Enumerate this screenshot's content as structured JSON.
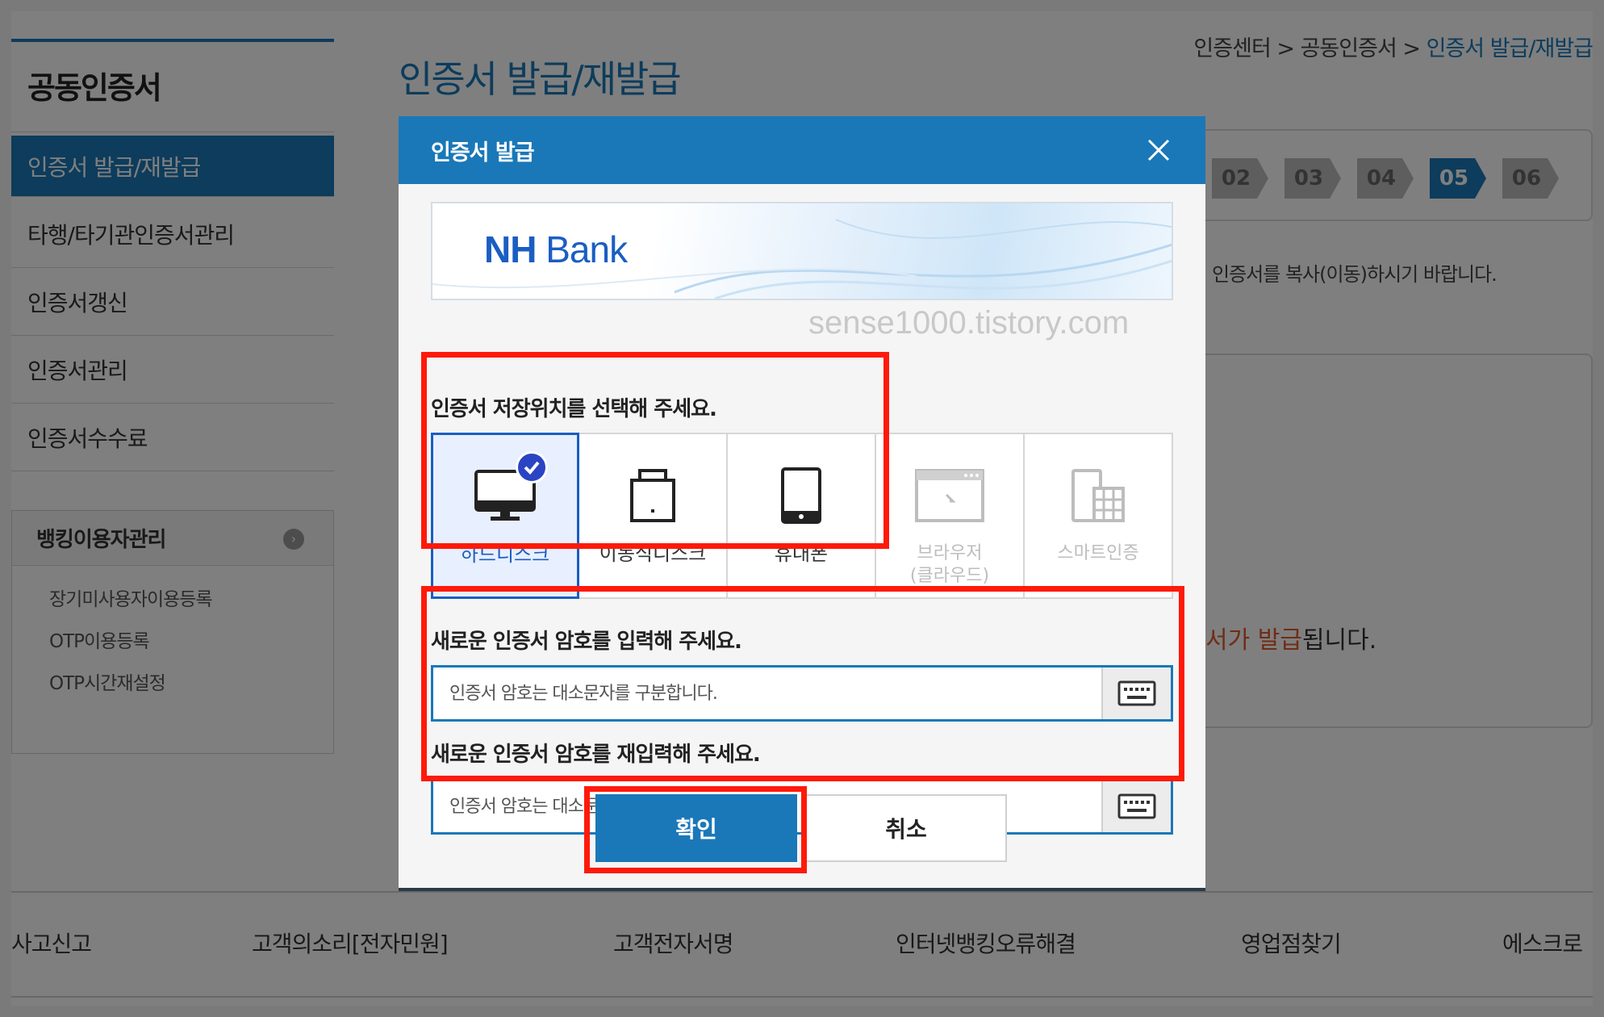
{
  "sidebar": {
    "title": "공동인증서",
    "items": [
      {
        "label": "인증서 발급/재발급",
        "active": true
      },
      {
        "label": "타행/타기관인증서관리"
      },
      {
        "label": "인증서갱신"
      },
      {
        "label": "인증서관리"
      },
      {
        "label": "인증서수수료"
      }
    ],
    "banking": {
      "title": "뱅킹이용자관리",
      "items": [
        "장기미사용자이용등록",
        "OTP이용등록",
        "OTP시간재설정"
      ]
    }
  },
  "main": {
    "title": "인증서 발급/재발급",
    "breadcrumb": {
      "part1": "인증센터",
      "sep1": " > ",
      "part2": "공동인증서",
      "sep2": " > ",
      "current": "인증서 발급/재발급"
    },
    "steps": [
      "02",
      "03",
      "04",
      "05",
      "06"
    ],
    "active_step": "05",
    "hint": "인증서를 복사(이동)하시기 바랍니다.",
    "issue_text_highlight": "서가 발급",
    "issue_text_rest": "됩니다."
  },
  "footer": {
    "links": [
      "사고신고",
      "고객의소리[전자민원]",
      "고객전자서명",
      "인터넷뱅킹오류해결",
      "영업점찾기",
      "에스크로"
    ]
  },
  "modal": {
    "title": "인증서 발급",
    "brand": {
      "nh": "NH",
      "bank": "Bank"
    },
    "watermark": "sense1000.tistory.com",
    "storage_label": "인증서 저장위치를 선택해 주세요.",
    "storage_options": [
      {
        "label": "하드디스크",
        "icon": "monitor-icon",
        "selected": true
      },
      {
        "label": "이동식디스크",
        "icon": "usb-drive-icon"
      },
      {
        "label": "휴대폰",
        "icon": "mobile-phone-icon"
      },
      {
        "label_line1": "브라우저",
        "label_line2": "(클라우드)",
        "icon": "browser-window-icon",
        "disabled": true
      },
      {
        "label": "스마트인증",
        "icon": "smart-auth-icon",
        "disabled": true
      }
    ],
    "password_label": "새로운 인증서 암호를 입력해 주세요.",
    "password_placeholder": "인증서 암호는 대소문자를 구분합니다.",
    "password_confirm_label": "새로운 인증서 암호를 재입력해 주세요.",
    "password_confirm_placeholder": "인증서 암호는 대소문자를 구분합니다.",
    "confirm_button": "확인",
    "cancel_button": "취소"
  },
  "colors": {
    "primary": "#1a78b8",
    "brand_blue": "#1a5ec2",
    "highlight_red": "#ff1a0a",
    "issue_orange": "#e05a2a"
  }
}
